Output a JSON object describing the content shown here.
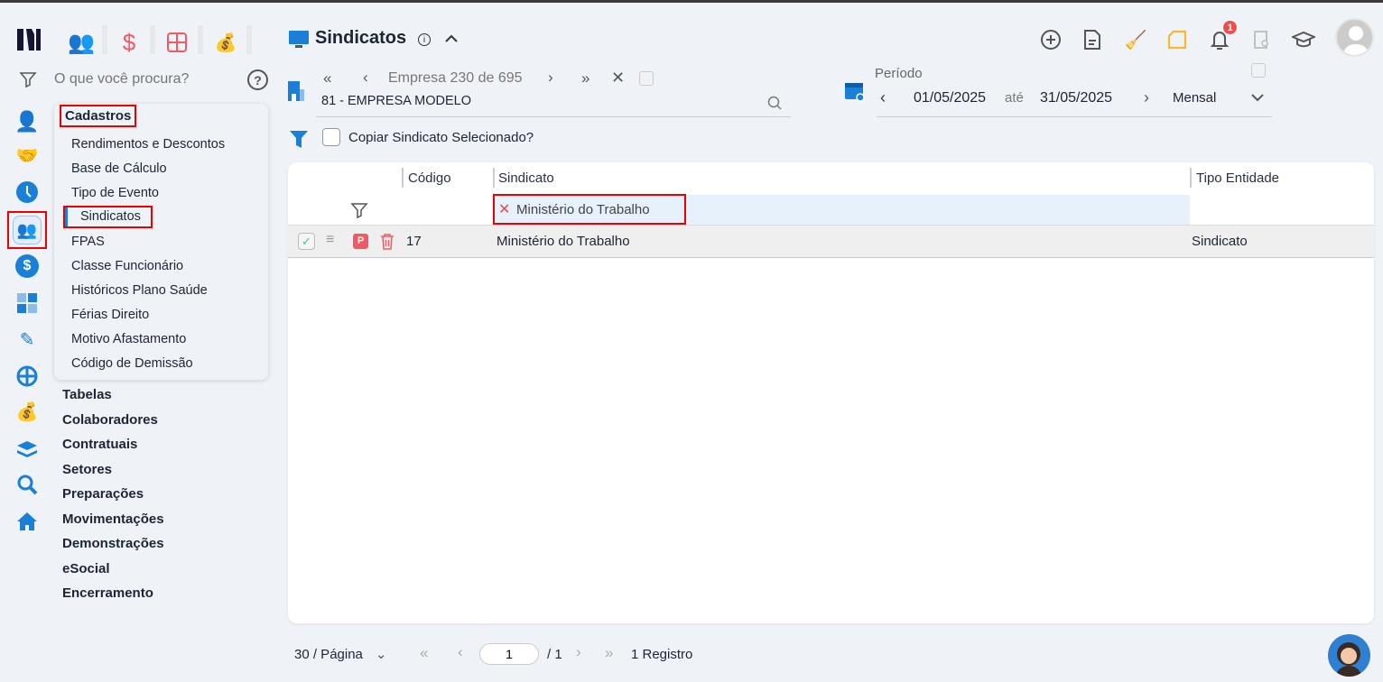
{
  "header": {
    "title": "Sindicatos",
    "info_icon": "info-icon",
    "collapse_icon": "chevron-up-icon"
  },
  "search": {
    "placeholder": "O que você procura?"
  },
  "top_modules": [
    "people-icon",
    "dollar-icon",
    "calculator-icon",
    "money-bag-icon"
  ],
  "rail_icons": [
    "user-settings-icon",
    "handshake-icon",
    "clock-icon",
    "users-icon",
    "dollar-circle-icon",
    "calculator-icon",
    "tools-icon",
    "network-icon",
    "money-bag-icon",
    "layers-icon",
    "search-icon",
    "home-icon"
  ],
  "menu": {
    "title": "Cadastros",
    "items": [
      "Rendimentos e Descontos",
      "Base de Cálculo",
      "Tipo de Evento",
      "Sindicatos",
      "FPAS",
      "Classe Funcionário",
      "Históricos Plano Saúde",
      "Férias Direito",
      "Motivo Afastamento",
      "Código de Demissão"
    ],
    "active": "Sindicatos"
  },
  "groups": [
    "Tabelas",
    "Colaboradores",
    "Contratuais",
    "Setores",
    "Preparações",
    "Movimentações",
    "Demonstrações",
    "eSocial",
    "Encerramento"
  ],
  "empresa": {
    "nav": "Empresa 230 de 695",
    "value": "81 - EMPRESA MODELO"
  },
  "periodo": {
    "label": "Período",
    "from": "01/05/2025",
    "sep": "até",
    "to": "31/05/2025",
    "mode": "Mensal"
  },
  "copy_label": "Copiar Sindicato Selecionado?",
  "notifications": {
    "count": "1"
  },
  "table": {
    "columns": [
      "Código",
      "Sindicato",
      "Tipo Entidade"
    ],
    "filter": {
      "sindicato": "Ministério do Trabalho"
    },
    "rows": [
      {
        "badge": "P",
        "codigo": "17",
        "sindicato": "Ministério do Trabalho",
        "tipo": "Sindicato"
      }
    ]
  },
  "pager": {
    "per_page": "30 / Página",
    "page": "1",
    "total": "/ 1",
    "records": "1 Registro"
  },
  "colors": {
    "accent": "#1a7fd6",
    "danger": "#f25a63",
    "highlight": "#e6f1fc"
  }
}
